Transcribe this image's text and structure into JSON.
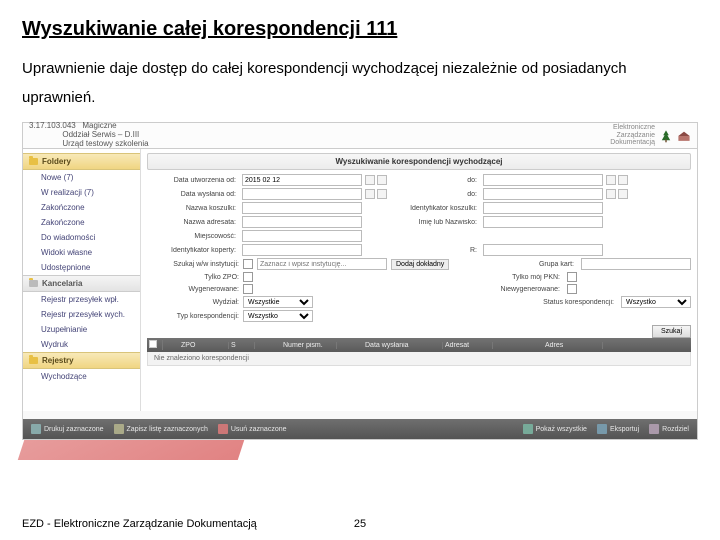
{
  "slide": {
    "title": "Wyszukiwanie całej korespondencji 111",
    "description": "Uprawnienie daje dostęp do całej korespondencji wychodzącej niezależnie od posiadanych uprawnień."
  },
  "topbar": {
    "ip": "3.17.103.043",
    "org1": "Magiczne",
    "org2": "Oddział Serwis – D.III",
    "org3": "Urząd testowy szkolenia",
    "brand1": "Elektroniczne",
    "brand2": "Zarządzanie",
    "brand3": "Dokumentacją"
  },
  "sidebar": {
    "sections": [
      {
        "header": "Foldery",
        "kind": "gold",
        "items": [
          "Nowe (7)",
          "W realizacji (7)",
          "Zakończone",
          "Zakończone",
          "Do wiadomości",
          "Widoki własne",
          "Udostępnione"
        ]
      },
      {
        "header": "Kancelaria",
        "kind": "grey",
        "items": [
          "Rejestr przesyłek wpł.",
          "Rejestr przesyłek wych.",
          "Uzupełnianie",
          "Wydruk"
        ]
      },
      {
        "header": "Rejestry",
        "kind": "gold",
        "items": [
          "Wychodzące"
        ]
      }
    ]
  },
  "panel": {
    "title": "Wyszukiwanie korespondencji wychodzącej"
  },
  "form": {
    "data_utw_od": "Data utworzenia od:",
    "data_utw_od_val": "2015 02 12",
    "do": "do:",
    "data_wys_od": "Data wysłania od:",
    "nazwa_koszulki": "Nazwa koszulki:",
    "ident_koszulki": "Identyfikator koszulki:",
    "nazwa_adresata": "Nazwa adresata:",
    "imie_nazwisko": "Imię lub Nazwisko:",
    "miejscowosc": "Miejscowość:",
    "ident_koperty": "Identyfikator koperty:",
    "r_label": "R:",
    "szukaj_instytucji": "Szukaj w/w instytucji:",
    "szukaj_placeholder": "Zaznacz i wpisz instytucję...",
    "dodaj_dokl": "Dodaj dokładny",
    "grupa_kart": "Grupa kart:",
    "tylko_zpo": "Tylko ZPO:",
    "tylko_moj_pkn": "Tylko mój PKN:",
    "wygenerowane": "Wygenerowane:",
    "niewygenerowane": "Niewygenerowane:",
    "wydzial": "Wydział:",
    "status": "Status korespondencji:",
    "typ": "Typ korespondencji:",
    "wszystkie": "Wszystkie",
    "wszystko": "Wszystko",
    "szukaj_btn": "Szukaj"
  },
  "table": {
    "cols": [
      "",
      "",
      "ZPO",
      "S",
      "",
      "Numer pism.",
      "",
      "Data wysłania",
      "Adresat",
      "",
      "Adres"
    ],
    "no_results": "Nie znaleziono korespondencji"
  },
  "actions": {
    "print": "Drukuj zaznaczone",
    "zip": "Zapisz listę zaznaczonych",
    "del": "Usuń zaznaczone",
    "show": "Pokaż wszystkie",
    "export": "Eksportuj",
    "split": "Rozdziel"
  },
  "footer": {
    "text": "EZD - Elektroniczne Zarządzanie Dokumentacją",
    "page": "25"
  }
}
